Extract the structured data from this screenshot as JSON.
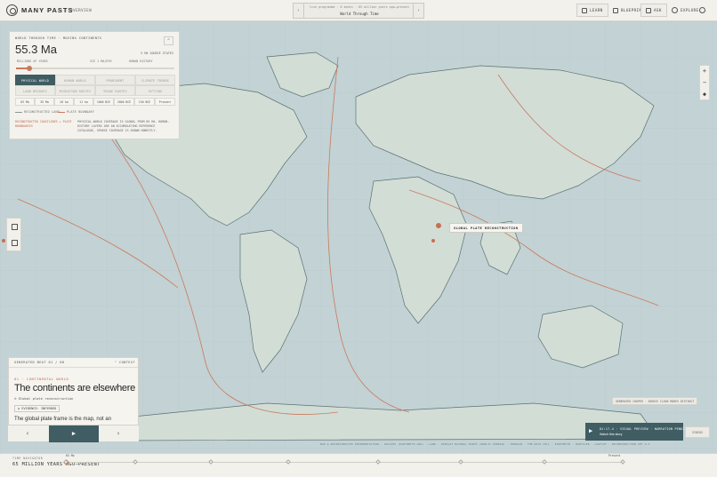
{
  "header": {
    "brand": "MANY PASTS",
    "overview": "‹ OVERVIEW",
    "story_sub": "live programme · 8 beats · 65 million years ago—present",
    "story_title": "World Through Time",
    "nav": [
      {
        "label": "LEARN",
        "icon": "book-icon"
      },
      {
        "label": "BLUEPRINT",
        "icon": "document-icon"
      },
      {
        "label": "ASK",
        "icon": "pen-icon"
      },
      {
        "label": "EXPLORE",
        "icon": "compass-icon"
      }
    ],
    "help_icon": "help-icon"
  },
  "panel": {
    "label": "WORLD THROUGH TIME · MOVING CONTINENTS",
    "age": "55.3 Ma",
    "source_state": "5 MA SOURCE STATES",
    "scale_labels": [
      "MILLIONS OF YEARS",
      "ICE 1 MA/KYR",
      "HUMAN HISTORY"
    ],
    "slider_value_fraction": 0.085,
    "tabs_row1": [
      "PHYSICAL WORLD",
      "HUMAN WORLD",
      "PROMINENT",
      "CLIMATE TRENDS"
    ],
    "tabs_row2": [
      "LAND BRIDGES",
      "MIGRATION ROUTES",
      "TRADE ROUTES",
      "SETTING"
    ],
    "ages": [
      "65 Ma",
      "35 Ma",
      "20 ka",
      "11 ka",
      "1000 BCE",
      "2000 BCE",
      "150 BCE",
      "Present"
    ],
    "legend": [
      "RECONSTRUCTED LAND",
      "PLATE BOUNDARY"
    ],
    "warn_left": "RECONSTRUCTED COASTLINES + PLATE BOUNDARIES",
    "warn_right": "PHYSICAL-WORLD COVERAGE IS GLOBAL FROM 65 MA. HUMAN-HISTORY LAYERS ARE AN ACCUMULATING REFERENCE CATALOGUE, SPARSE COVERAGE IS SHOWN HONESTLY."
  },
  "map": {
    "tooltip": "GLOBAL PLATE RECONSTRUCTION",
    "colors": {
      "ocean": "#c3d2d4",
      "land": "#d2ddd6",
      "coast": "#5a7272",
      "plate": "#c97a5e"
    }
  },
  "card": {
    "head_left": "GENERATED BEAT 01 / 08",
    "head_right": "CONTEXT",
    "eyebrow": "01 · CONTINENTAL WORLD",
    "headline": "The continents are elsewhere",
    "source": "Global plate reconstruction",
    "evidence": "EVIDENCE: INFERRED",
    "body": "The global plate frame is the map, not an"
  },
  "player": {
    "line1": "01:17.4 · VISUAL PREVIEW · NARRATION PENDING",
    "line2": "Watch this story",
    "videos": "VIDEOS",
    "badge": "GENERATED CHAPER · SOURCE CLEAR MORES DISTINCT"
  },
  "credits": "MAP & RECONSTRUCTED INTERPRETATION · GPLATES (EARTHBYTE.ORG) · LAND · POPULAT NATURAL EARTH (PUBLIC DOMAIN) · TERRAIN · THE DATA CELL · EARTHBYTE · MAPTILER · LEAFLET · RECONSTRUCTION SET 2.5",
  "timeline": {
    "label": "TIME NAVIGATOR",
    "value": "65 MILLION YEARS AGO—PRESENT",
    "current_label": "65 Ma",
    "present_label": "Present",
    "tick_positions": [
      0.0,
      0.125,
      0.26,
      0.4,
      0.56,
      0.71,
      0.86,
      1.0
    ]
  }
}
